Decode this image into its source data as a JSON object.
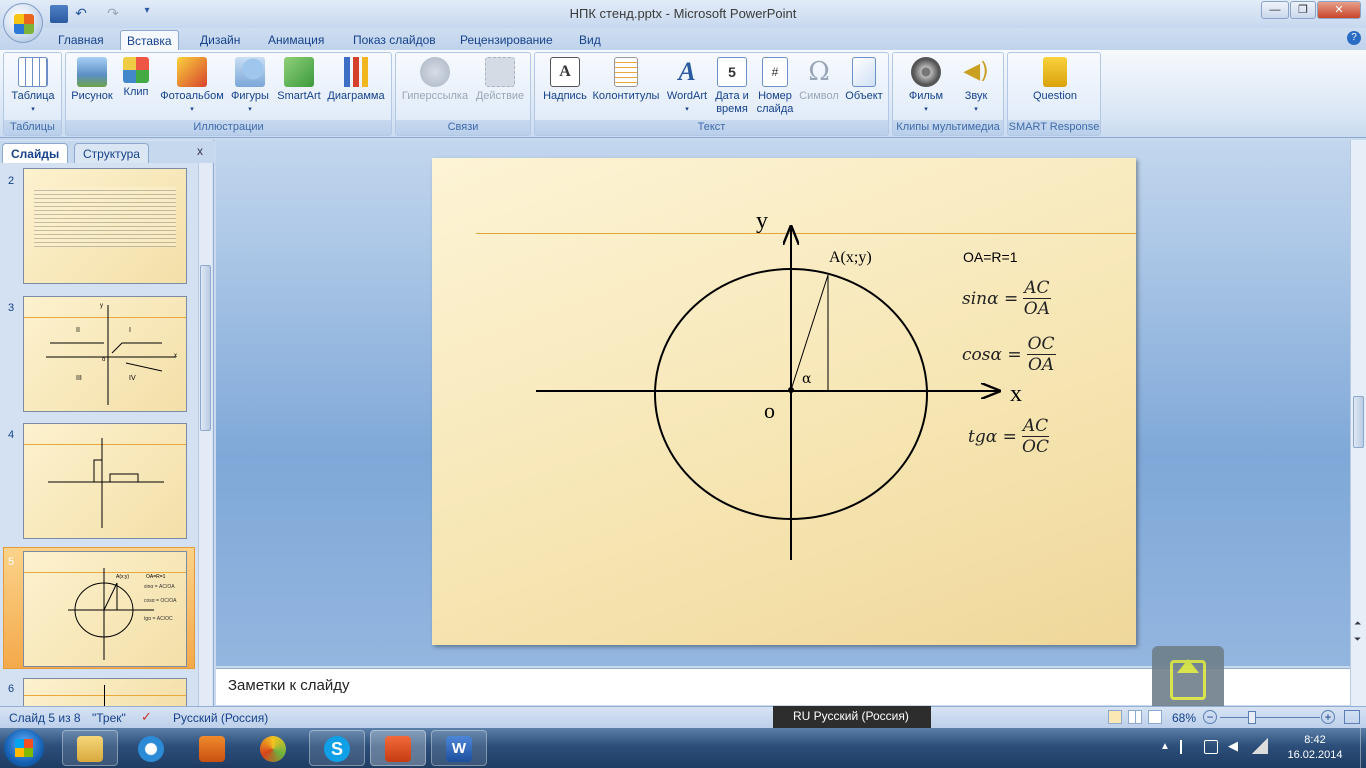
{
  "window": {
    "title": "НПК стенд.pptx - Microsoft PowerPoint"
  },
  "tabs": [
    "Главная",
    "Вставка",
    "Дизайн",
    "Анимация",
    "Показ слайдов",
    "Рецензирование",
    "Вид"
  ],
  "active_tab": "Вставка",
  "ribbon": {
    "groups": [
      {
        "label": "Таблицы",
        "buttons": [
          {
            "l1": "Таблица",
            "l2": "",
            "icon": "table-icon"
          }
        ]
      },
      {
        "label": "Иллюстрации",
        "buttons": [
          {
            "l1": "Рисунок",
            "l2": "",
            "icon": "picture-icon"
          },
          {
            "l1": "Клип",
            "l2": "",
            "icon": "clipart-icon"
          },
          {
            "l1": "Фотоальбом",
            "l2": "",
            "icon": "photoalbum-icon"
          },
          {
            "l1": "Фигуры",
            "l2": "",
            "icon": "shapes-icon"
          },
          {
            "l1": "SmartArt",
            "l2": "",
            "icon": "smartart-icon"
          },
          {
            "l1": "Диаграмма",
            "l2": "",
            "icon": "chart-icon"
          }
        ]
      },
      {
        "label": "Связи",
        "buttons": [
          {
            "l1": "Гиперссылка",
            "l2": "",
            "icon": "hyperlink-icon"
          },
          {
            "l1": "Действие",
            "l2": "",
            "icon": "action-icon"
          }
        ]
      },
      {
        "label": "Текст",
        "buttons": [
          {
            "l1": "Надпись",
            "l2": "",
            "icon": "textbox-icon"
          },
          {
            "l1": "Колонтитулы",
            "l2": "",
            "icon": "header-footer-icon"
          },
          {
            "l1": "WordArt",
            "l2": "",
            "icon": "wordart-icon"
          },
          {
            "l1": "Дата и",
            "l2": "время",
            "icon": "date-time-icon"
          },
          {
            "l1": "Номер",
            "l2": "слайда",
            "icon": "slide-number-icon"
          },
          {
            "l1": "Символ",
            "l2": "",
            "icon": "symbol-icon"
          },
          {
            "l1": "Объект",
            "l2": "",
            "icon": "object-icon"
          }
        ]
      },
      {
        "label": "Клипы мультимедиа",
        "buttons": [
          {
            "l1": "Фильм",
            "l2": "",
            "icon": "movie-icon"
          },
          {
            "l1": "Звук",
            "l2": "",
            "icon": "sound-icon"
          }
        ]
      },
      {
        "label": "SMART Response",
        "buttons": [
          {
            "l1": "Question",
            "l2": "",
            "icon": "question-icon"
          }
        ]
      }
    ]
  },
  "pane_tabs": [
    "Слайды",
    "Структура"
  ],
  "slide_numbers": [
    "2",
    "3",
    "4",
    "5",
    "6"
  ],
  "thumb3": {
    "q1": "I",
    "q2": "II",
    "q3": "III",
    "q4": "IV",
    "y": "y",
    "x": "x",
    "o": "o"
  },
  "thumb5": {
    "ax": "A(x;y)",
    "r": "OA=R=1",
    "sin": "sinα = AC/OA",
    "cos": "cosα = OC/OA",
    "tg": "tgα = AC/OC"
  },
  "slide": {
    "axis_y": "y",
    "axis_x": "x",
    "origin": "o",
    "angle": "α",
    "point_a": "A(x;y)",
    "radius_note": "OA=R=1",
    "sin_label": "sinα =",
    "sin_num": "AC",
    "sin_den": "OA",
    "cos_label": "cosα =",
    "cos_num": "OC",
    "cos_den": "OA",
    "tg_label": "tgα =",
    "tg_num": "AC",
    "tg_den": "OC"
  },
  "notes": {
    "placeholder": "Заметки к слайду"
  },
  "status": {
    "slide_of": "Слайд 5 из 8",
    "theme": "\"Трек\"",
    "language": "Русский (Россия)",
    "zoom": "68%"
  },
  "langbar": {
    "text": "RU Русский (Россия)"
  },
  "clock": {
    "time": "8:42",
    "date": "16.02.2014"
  }
}
